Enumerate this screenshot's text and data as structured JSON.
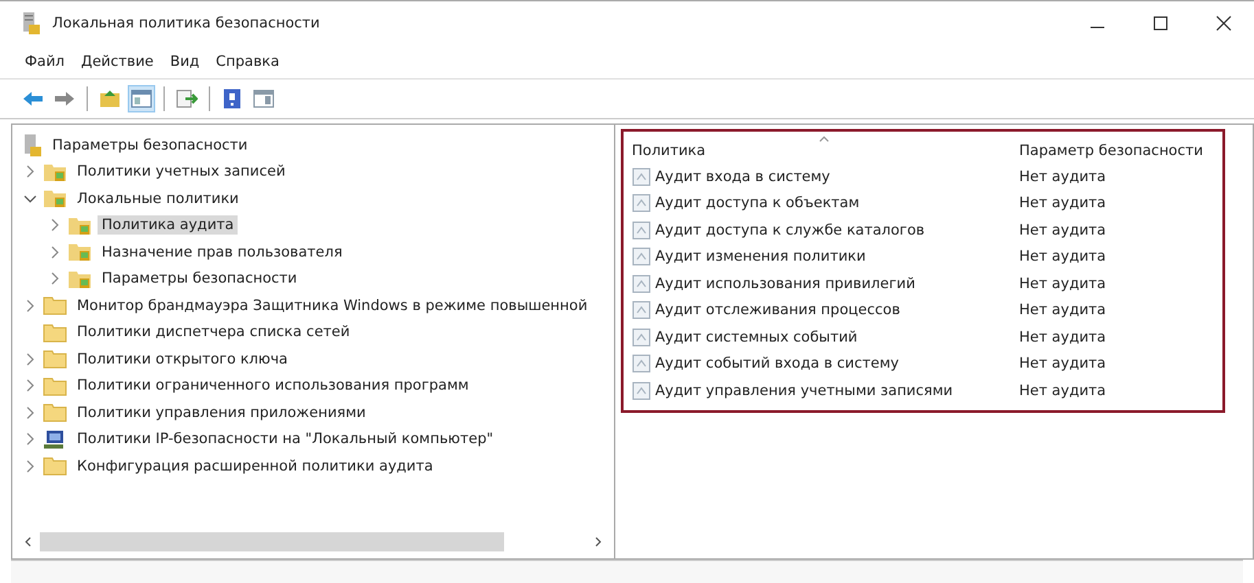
{
  "window": {
    "title": "Локальная политика безопасности"
  },
  "menu": [
    "Файл",
    "Действие",
    "Вид",
    "Справка"
  ],
  "toolbar": [
    {
      "kind": "back"
    },
    {
      "kind": "forward"
    },
    {
      "kind": "sep"
    },
    {
      "kind": "up"
    },
    {
      "kind": "console",
      "selected": true
    },
    {
      "kind": "sep"
    },
    {
      "kind": "export"
    },
    {
      "kind": "sep"
    },
    {
      "kind": "help"
    },
    {
      "kind": "pane"
    }
  ],
  "tree": {
    "label": "Параметры безопасности",
    "children": [
      {
        "label": "Политики учетных записей",
        "kind": "lock-folder",
        "expanded": false,
        "selected": false
      },
      {
        "label": "Локальные политики",
        "kind": "lock-folder",
        "expanded": true,
        "selected": false,
        "children": [
          {
            "label": "Политика аудита",
            "kind": "lock-folder",
            "expanded": false,
            "selected": true
          },
          {
            "label": "Назначение прав пользователя",
            "kind": "lock-folder",
            "expanded": false,
            "selected": false
          },
          {
            "label": "Параметры безопасности",
            "kind": "lock-folder",
            "expanded": false,
            "selected": false
          }
        ]
      },
      {
        "label": "Монитор брандмауэра Защитника Windows в режиме повышенной",
        "kind": "folder",
        "expanded": false,
        "selected": false
      },
      {
        "label": "Политики диспетчера списка сетей",
        "kind": "folder",
        "selected": false
      },
      {
        "label": "Политики открытого ключа",
        "kind": "folder",
        "expanded": false,
        "selected": false
      },
      {
        "label": "Политики ограниченного использования программ",
        "kind": "folder",
        "expanded": false,
        "selected": false
      },
      {
        "label": "Политики управления приложениями",
        "kind": "folder",
        "expanded": false,
        "selected": false
      },
      {
        "label": "Политики IP-безопасности на \"Локальный компьютер\"",
        "kind": "computer",
        "expanded": false,
        "selected": false
      },
      {
        "label": "Конфигурация расширенной политики аудита",
        "kind": "folder",
        "expanded": false,
        "selected": false
      }
    ]
  },
  "table": {
    "columns": [
      "Политика",
      "Параметр безопасности"
    ],
    "rows": [
      [
        "Аудит входа в систему",
        "Нет аудита"
      ],
      [
        "Аудит доступа к объектам",
        "Нет аудита"
      ],
      [
        "Аудит доступа к службе каталогов",
        "Нет аудита"
      ],
      [
        "Аудит изменения политики",
        "Нет аудита"
      ],
      [
        "Аудит использования привилегий",
        "Нет аудита"
      ],
      [
        "Аудит отслеживания процессов",
        "Нет аудита"
      ],
      [
        "Аудит системных событий",
        "Нет аудита"
      ],
      [
        "Аудит событий входа в систему",
        "Нет аудита"
      ],
      [
        "Аудит управления учетными записями",
        "Нет аудита"
      ]
    ]
  }
}
